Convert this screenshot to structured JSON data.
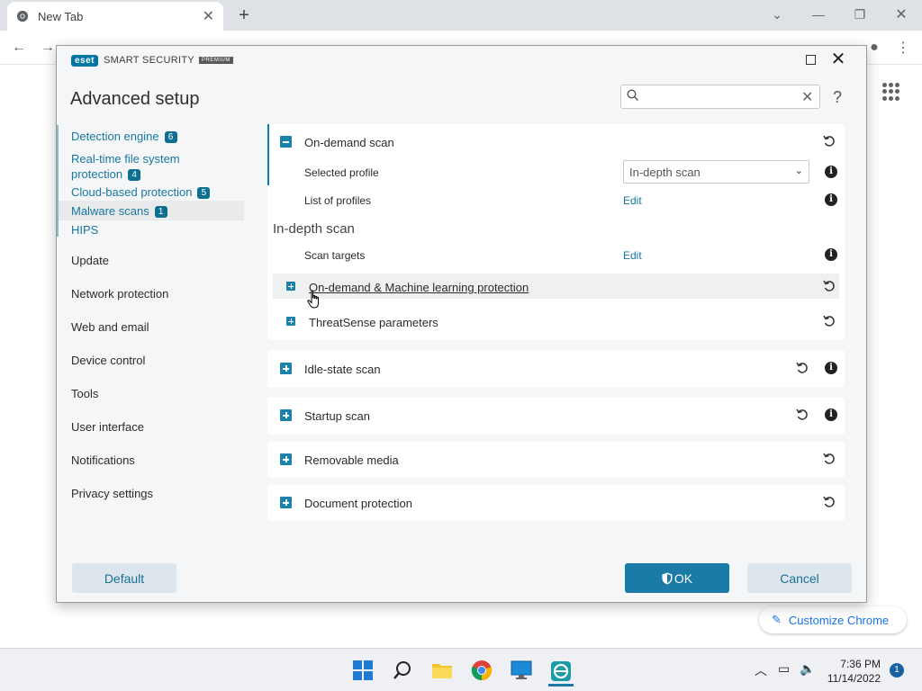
{
  "browser": {
    "tab_title": "New Tab",
    "tab_close": "✕",
    "new_tab": "+",
    "customize_label": "Customize Chrome"
  },
  "dialog": {
    "logo_text": "eset",
    "product_name": "SMART SECURITY",
    "product_edition": "PREMIUM",
    "title": "Advanced setup",
    "search_placeholder": "",
    "help": "?",
    "close": "✕"
  },
  "sidebar": {
    "items": [
      {
        "label": "Detection engine",
        "badge": "6"
      },
      {
        "label": "Real-time file system",
        "label2": "protection",
        "badge": "4"
      },
      {
        "label": "Cloud-based protection",
        "badge": "5"
      },
      {
        "label": "Malware scans",
        "badge": "1"
      },
      {
        "label": "HIPS"
      },
      {
        "label": "Update"
      },
      {
        "label": "Network protection"
      },
      {
        "label": "Web and email"
      },
      {
        "label": "Device control"
      },
      {
        "label": "Tools"
      },
      {
        "label": "User interface"
      },
      {
        "label": "Notifications"
      },
      {
        "label": "Privacy settings"
      }
    ]
  },
  "content": {
    "on_demand": {
      "title": "On-demand scan",
      "selected_profile_label": "Selected profile",
      "selected_profile_value": "In-depth scan",
      "list_of_profiles_label": "List of profiles",
      "edit_label": "Edit",
      "subheading": "In-depth scan",
      "scan_targets_label": "Scan targets",
      "ml_protection": "On-demand & Machine learning protection",
      "threatsense": "ThreatSense parameters"
    },
    "sections": [
      {
        "title": "Idle-state scan"
      },
      {
        "title": "Startup scan"
      },
      {
        "title": "Removable media"
      },
      {
        "title": "Document protection"
      }
    ]
  },
  "buttons": {
    "default": "Default",
    "ok": "OK",
    "cancel": "Cancel"
  },
  "taskbar": {
    "time": "7:36 PM",
    "date": "11/14/2022",
    "notifications": "1"
  },
  "colors": {
    "accent": "#1a7ca6",
    "link": "#1777a0",
    "badge": "#0c6f8f"
  }
}
